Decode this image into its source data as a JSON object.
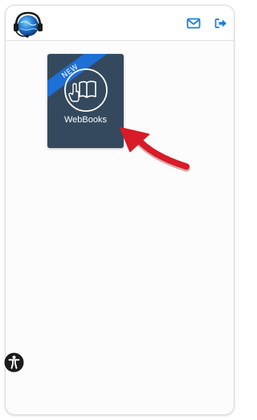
{
  "tile": {
    "label": "WebBooks",
    "badge": "NEW"
  },
  "icons": {
    "logo": "headset-globe-logo",
    "mail": "envelope-icon",
    "logout": "sign-out-icon",
    "tile": "book-with-pointer-hand-icon",
    "accessibility": "accessibility-person-icon",
    "annotation": "red-arrow"
  },
  "colors": {
    "tile_bg": "#34495e",
    "ribbon": "#1e6fd6",
    "toolbar_icons": "#1a7fe0",
    "annotation_arrow": "#d81b28"
  }
}
